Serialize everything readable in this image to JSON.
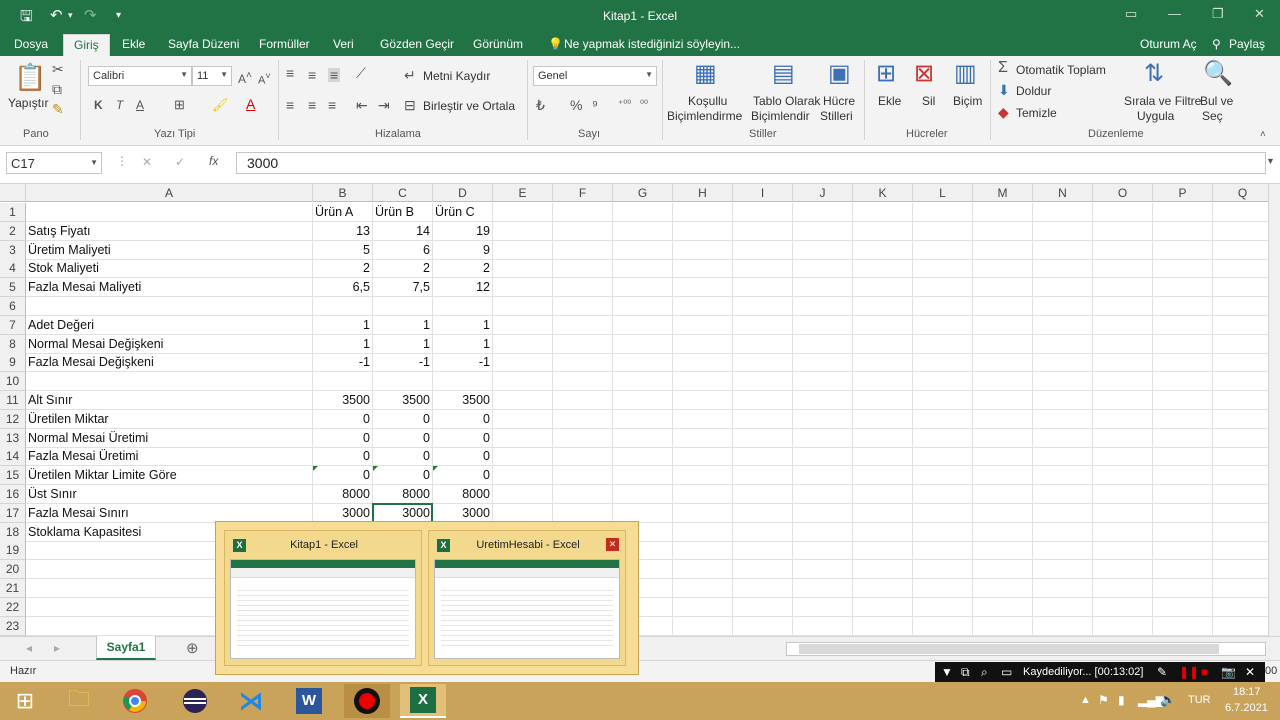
{
  "window": {
    "title": "Kitap1 - Excel",
    "restore_icon": "restore-icon",
    "min_icon": "minimize-icon",
    "max_icon": "maximize-icon",
    "close_icon": "close-icon"
  },
  "tabs": [
    "Dosya",
    "Giriş",
    "Ekle",
    "Sayfa Düzeni",
    "Formüller",
    "Veri",
    "Gözden Geçir",
    "Görünüm"
  ],
  "active_tab": "Giriş",
  "tell_me": "Ne yapmak istediğinizi söyleyin...",
  "sign_in": "Oturum Aç",
  "share": "Paylaş",
  "ribbon": {
    "paste": "Yapıştır",
    "font_name": "Calibri",
    "font_size": "11",
    "bold": "K",
    "italic": "T",
    "underline": "A",
    "wrap_text": "Metni Kaydır",
    "merge_center": "Birleştir ve Ortala",
    "number_format": "Genel",
    "percent": "%",
    "comma": "⁹",
    "cond_format_1": "Koşullu",
    "cond_format_2": "Biçimlendirme",
    "format_table_1": "Tablo Olarak",
    "format_table_2": "Biçimlendir",
    "cell_styles_1": "Hücre",
    "cell_styles_2": "Stilleri",
    "insert": "Ekle",
    "delete": "Sil",
    "format": "Biçim",
    "autosum": "Otomatik Toplam",
    "fill": "Doldur",
    "clear": "Temizle",
    "sort_filter_1": "Sırala ve Filtre",
    "sort_filter_2": "Uygula",
    "find_1": "Bul ve",
    "find_2": "Seç",
    "groups": [
      "Pano",
      "Yazı Tipi",
      "Hizalama",
      "Sayı",
      "Stiller",
      "Hücreler",
      "Düzenleme"
    ]
  },
  "formula_bar": {
    "name_box": "C17",
    "cancel": "✕",
    "enter": "✓",
    "fx": "fx",
    "value": "3000"
  },
  "columns": [
    "A",
    "B",
    "C",
    "D",
    "E",
    "F",
    "G",
    "H",
    "I",
    "J",
    "K",
    "L",
    "M",
    "N",
    "O",
    "P",
    "Q"
  ],
  "rows": [
    [
      "",
      "Ürün A",
      "Ürün B",
      "Ürün C"
    ],
    [
      "Satış Fiyatı",
      "13",
      "14",
      "19"
    ],
    [
      "Üretim Maliyeti",
      "5",
      "6",
      "9"
    ],
    [
      "Stok Maliyeti",
      "2",
      "2",
      "2"
    ],
    [
      "Fazla Mesai Maliyeti",
      "6,5",
      "7,5",
      "12"
    ],
    [
      "",
      "",
      "",
      ""
    ],
    [
      "Adet Değeri",
      "1",
      "1",
      "1"
    ],
    [
      "Normal Mesai Değişkeni",
      "1",
      "1",
      "1"
    ],
    [
      "Fazla Mesai Değişkeni",
      "-1",
      "-1",
      "-1"
    ],
    [
      "",
      "",
      "",
      ""
    ],
    [
      "Alt Sınır",
      "3500",
      "3500",
      "3500"
    ],
    [
      "Üretilen Miktar",
      "0",
      "0",
      "0"
    ],
    [
      "Normal Mesai Üretimi",
      "0",
      "0",
      "0"
    ],
    [
      "Fazla Mesai Üretimi",
      "0",
      "0",
      "0"
    ],
    [
      "Üretilen Miktar Limite Göre",
      "0",
      "0",
      "0"
    ],
    [
      "Üst Sınır",
      "8000",
      "8000",
      "8000"
    ],
    [
      "Fazla Mesai Sınırı",
      "3000",
      "3000",
      "3000"
    ],
    [
      "Stoklama Kapasitesi",
      "",
      "",
      ""
    ],
    [
      "",
      "",
      "",
      ""
    ],
    [
      "",
      "",
      "",
      ""
    ],
    [
      "",
      "",
      "",
      ""
    ],
    [
      "",
      "",
      "",
      ""
    ],
    [
      "",
      "",
      "",
      ""
    ]
  ],
  "sheet_tab": "Sayfa1",
  "add_sheet": "⊕",
  "status": "Hazır",
  "popup": {
    "thumb1": "Kitap1 - Excel",
    "thumb2": "UretimHesabi - Excel"
  },
  "recorder": {
    "text": "Kaydediliyor... [00:13:02]",
    "trailing": "00"
  },
  "tray": {
    "lang": "TUR",
    "time": "18:17",
    "date": "6.7.2021"
  },
  "colors": {
    "accent": "#217346",
    "taskbar": "#c9a35a",
    "popup": "#f7dc95"
  }
}
